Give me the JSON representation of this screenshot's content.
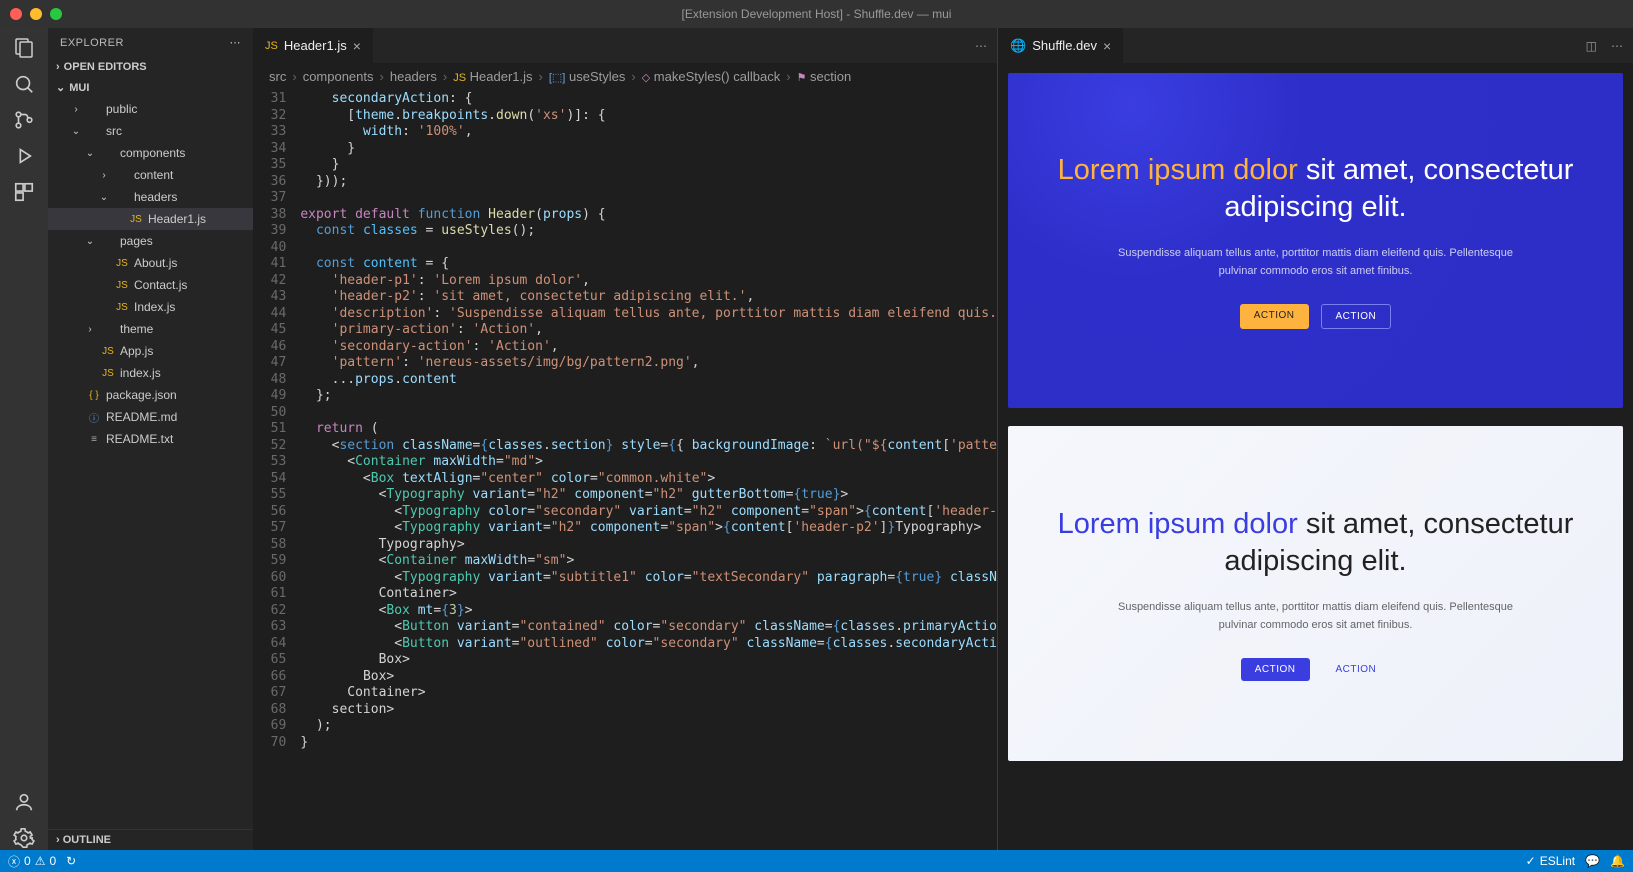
{
  "title": "[Extension Development Host] - Shuffle.dev — mui",
  "explorer": {
    "title": "EXPLORER",
    "outline": "OUTLINE",
    "openEditors": "OPEN EDITORS",
    "root": "MUI"
  },
  "tree": [
    {
      "label": "public",
      "icon": "folder",
      "depth": 1,
      "chev": "›"
    },
    {
      "label": "src",
      "icon": "folder",
      "depth": 1,
      "chev": "⌄"
    },
    {
      "label": "components",
      "icon": "folder",
      "depth": 2,
      "chev": "⌄"
    },
    {
      "label": "content",
      "icon": "folder",
      "depth": 3,
      "chev": "›"
    },
    {
      "label": "headers",
      "icon": "folder",
      "depth": 3,
      "chev": "⌄"
    },
    {
      "label": "Header1.js",
      "icon": "js",
      "depth": 4,
      "chev": "",
      "selected": true
    },
    {
      "label": "pages",
      "icon": "folder",
      "depth": 2,
      "chev": "⌄"
    },
    {
      "label": "About.js",
      "icon": "js",
      "depth": 3,
      "chev": ""
    },
    {
      "label": "Contact.js",
      "icon": "js",
      "depth": 3,
      "chev": ""
    },
    {
      "label": "Index.js",
      "icon": "js",
      "depth": 3,
      "chev": ""
    },
    {
      "label": "theme",
      "icon": "folder",
      "depth": 2,
      "chev": "›"
    },
    {
      "label": "App.js",
      "icon": "js",
      "depth": 2,
      "chev": ""
    },
    {
      "label": "index.js",
      "icon": "js",
      "depth": 2,
      "chev": ""
    },
    {
      "label": "package.json",
      "icon": "json",
      "depth": 1,
      "chev": ""
    },
    {
      "label": "README.md",
      "icon": "md",
      "depth": 1,
      "chev": ""
    },
    {
      "label": "README.txt",
      "icon": "txt",
      "depth": 1,
      "chev": ""
    }
  ],
  "tab": {
    "label": "Header1.js"
  },
  "crumbs": [
    "src",
    "components",
    "headers",
    "Header1.js",
    "useStyles",
    "makeStyles() callback",
    "section"
  ],
  "code": {
    "start": 31,
    "lines": [
      [
        [
          "a",
          "    secondaryAction"
        ],
        [
          "d",
          ": {"
        ]
      ],
      [
        [
          "d",
          "      ["
        ],
        [
          "a",
          "theme"
        ],
        [
          "d",
          "."
        ],
        [
          "a",
          "breakpoints"
        ],
        [
          "d",
          "."
        ],
        [
          "f",
          "down"
        ],
        [
          "d",
          "("
        ],
        [
          "s",
          "'xs'"
        ],
        [
          "d",
          ")]: {"
        ]
      ],
      [
        [
          "d",
          "        "
        ],
        [
          "a",
          "width"
        ],
        [
          "d",
          ": "
        ],
        [
          "s",
          "'100%'"
        ],
        [
          "d",
          ","
        ]
      ],
      [
        [
          "d",
          "      }"
        ]
      ],
      [
        [
          "d",
          "    }"
        ]
      ],
      [
        [
          "d",
          "  }));"
        ]
      ],
      [
        [
          "d",
          ""
        ]
      ],
      [
        [
          "k",
          "export default "
        ],
        [
          "p",
          "function "
        ],
        [
          "f",
          "Header"
        ],
        [
          "d",
          "("
        ],
        [
          "a",
          "props"
        ],
        [
          "d",
          ") {"
        ]
      ],
      [
        [
          "d",
          "  "
        ],
        [
          "p",
          "const "
        ],
        [
          "c",
          "classes"
        ],
        [
          "d",
          " = "
        ],
        [
          "f",
          "useStyles"
        ],
        [
          "d",
          "();"
        ]
      ],
      [
        [
          "d",
          ""
        ]
      ],
      [
        [
          "d",
          "  "
        ],
        [
          "p",
          "const "
        ],
        [
          "c",
          "content"
        ],
        [
          "d",
          " = {"
        ]
      ],
      [
        [
          "d",
          "    "
        ],
        [
          "s",
          "'header-p1'"
        ],
        [
          "d",
          ": "
        ],
        [
          "s",
          "'Lorem ipsum dolor'"
        ],
        [
          "d",
          ","
        ]
      ],
      [
        [
          "d",
          "    "
        ],
        [
          "s",
          "'header-p2'"
        ],
        [
          "d",
          ": "
        ],
        [
          "s",
          "'sit amet, consectetur adipiscing elit.'"
        ],
        [
          "d",
          ","
        ]
      ],
      [
        [
          "d",
          "    "
        ],
        [
          "s",
          "'description'"
        ],
        [
          "d",
          ": "
        ],
        [
          "s",
          "'Suspendisse aliquam tellus ante, porttitor mattis diam eleifend quis."
        ]
      ],
      [
        [
          "d",
          "    "
        ],
        [
          "s",
          "'primary-action'"
        ],
        [
          "d",
          ": "
        ],
        [
          "s",
          "'Action'"
        ],
        [
          "d",
          ","
        ]
      ],
      [
        [
          "d",
          "    "
        ],
        [
          "s",
          "'secondary-action'"
        ],
        [
          "d",
          ": "
        ],
        [
          "s",
          "'Action'"
        ],
        [
          "d",
          ","
        ]
      ],
      [
        [
          "d",
          "    "
        ],
        [
          "s",
          "'pattern'"
        ],
        [
          "d",
          ": "
        ],
        [
          "s",
          "'nereus-assets/img/bg/pattern2.png'"
        ],
        [
          "d",
          ","
        ]
      ],
      [
        [
          "d",
          "    ..."
        ],
        [
          "a",
          "props"
        ],
        [
          "d",
          "."
        ],
        [
          "a",
          "content"
        ]
      ],
      [
        [
          "d",
          "  };"
        ]
      ],
      [
        [
          "d",
          ""
        ]
      ],
      [
        [
          "d",
          "  "
        ],
        [
          "k",
          "return"
        ],
        [
          "d",
          " ("
        ]
      ],
      [
        [
          "d",
          "    <"
        ],
        [
          "p",
          "section "
        ],
        [
          "a",
          "className"
        ],
        [
          "d",
          "="
        ],
        [
          "p",
          "{"
        ],
        [
          "a",
          "classes"
        ],
        [
          "d",
          "."
        ],
        [
          "a",
          "section"
        ],
        [
          "p",
          "} "
        ],
        [
          "a",
          "style"
        ],
        [
          "d",
          "="
        ],
        [
          "p",
          "{"
        ],
        [
          "d",
          "{ "
        ],
        [
          "a",
          "backgroundImage"
        ],
        [
          "d",
          ": "
        ],
        [
          "s",
          "`url(\"${"
        ],
        [
          "a",
          "content"
        ],
        [
          "d",
          "["
        ],
        [
          "s",
          "'patte"
        ]
      ],
      [
        [
          "d",
          "      <"
        ],
        [
          "t",
          "Container "
        ],
        [
          "a",
          "maxWidth"
        ],
        [
          "d",
          "="
        ],
        [
          "s",
          "\"md\""
        ],
        [
          "d",
          ">"
        ]
      ],
      [
        [
          "d",
          "        <"
        ],
        [
          "t",
          "Box "
        ],
        [
          "a",
          "textAlign"
        ],
        [
          "d",
          "="
        ],
        [
          "s",
          "\"center\" "
        ],
        [
          "a",
          "color"
        ],
        [
          "d",
          "="
        ],
        [
          "s",
          "\"common.white\""
        ],
        [
          "d",
          ">"
        ]
      ],
      [
        [
          "d",
          "          <"
        ],
        [
          "t",
          "Typography "
        ],
        [
          "a",
          "variant"
        ],
        [
          "d",
          "="
        ],
        [
          "s",
          "\"h2\" "
        ],
        [
          "a",
          "component"
        ],
        [
          "d",
          "="
        ],
        [
          "s",
          "\"h2\" "
        ],
        [
          "a",
          "gutterBottom"
        ],
        [
          "d",
          "="
        ],
        [
          "p",
          "{"
        ],
        [
          "p",
          "true"
        ],
        [
          "p",
          "}"
        ],
        [
          "d",
          ">"
        ]
      ],
      [
        [
          "d",
          "            <"
        ],
        [
          "t",
          "Typography "
        ],
        [
          "a",
          "color"
        ],
        [
          "d",
          "="
        ],
        [
          "s",
          "\"secondary\" "
        ],
        [
          "a",
          "variant"
        ],
        [
          "d",
          "="
        ],
        [
          "s",
          "\"h2\" "
        ],
        [
          "a",
          "component"
        ],
        [
          "d",
          "="
        ],
        [
          "s",
          "\"span\""
        ],
        [
          "d",
          ">"
        ],
        [
          "p",
          "{"
        ],
        [
          "a",
          "content"
        ],
        [
          "d",
          "["
        ],
        [
          "s",
          "'header-"
        ]
      ],
      [
        [
          "d",
          "            <"
        ],
        [
          "t",
          "Typography "
        ],
        [
          "a",
          "variant"
        ],
        [
          "d",
          "="
        ],
        [
          "s",
          "\"h2\" "
        ],
        [
          "a",
          "component"
        ],
        [
          "d",
          "="
        ],
        [
          "s",
          "\"span\""
        ],
        [
          "d",
          ">"
        ],
        [
          "p",
          "{"
        ],
        [
          "a",
          "content"
        ],
        [
          "d",
          "["
        ],
        [
          "s",
          "'header-p2'"
        ],
        [
          "d",
          "]"
        ],
        [
          "p",
          "}"
        ],
        [
          "d",
          "</"
        ],
        [
          "t",
          "Typography"
        ],
        [
          "d",
          ">"
        ]
      ],
      [
        [
          "d",
          "          </"
        ],
        [
          "t",
          "Typography"
        ],
        [
          "d",
          ">"
        ]
      ],
      [
        [
          "d",
          "          <"
        ],
        [
          "t",
          "Container "
        ],
        [
          "a",
          "maxWidth"
        ],
        [
          "d",
          "="
        ],
        [
          "s",
          "\"sm\""
        ],
        [
          "d",
          ">"
        ]
      ],
      [
        [
          "d",
          "            <"
        ],
        [
          "t",
          "Typography "
        ],
        [
          "a",
          "variant"
        ],
        [
          "d",
          "="
        ],
        [
          "s",
          "\"subtitle1\" "
        ],
        [
          "a",
          "color"
        ],
        [
          "d",
          "="
        ],
        [
          "s",
          "\"textSecondary\" "
        ],
        [
          "a",
          "paragraph"
        ],
        [
          "d",
          "="
        ],
        [
          "p",
          "{"
        ],
        [
          "p",
          "true"
        ],
        [
          "p",
          "} "
        ],
        [
          "a",
          "classN"
        ]
      ],
      [
        [
          "d",
          "          </"
        ],
        [
          "t",
          "Container"
        ],
        [
          "d",
          ">"
        ]
      ],
      [
        [
          "d",
          "          <"
        ],
        [
          "t",
          "Box "
        ],
        [
          "a",
          "mt"
        ],
        [
          "d",
          "="
        ],
        [
          "p",
          "{"
        ],
        [
          "n",
          "3"
        ],
        [
          "p",
          "}"
        ],
        [
          "d",
          ">"
        ]
      ],
      [
        [
          "d",
          "            <"
        ],
        [
          "t",
          "Button "
        ],
        [
          "a",
          "variant"
        ],
        [
          "d",
          "="
        ],
        [
          "s",
          "\"contained\" "
        ],
        [
          "a",
          "color"
        ],
        [
          "d",
          "="
        ],
        [
          "s",
          "\"secondary\" "
        ],
        [
          "a",
          "className"
        ],
        [
          "d",
          "="
        ],
        [
          "p",
          "{"
        ],
        [
          "a",
          "classes"
        ],
        [
          "d",
          "."
        ],
        [
          "a",
          "primaryActio"
        ]
      ],
      [
        [
          "d",
          "            <"
        ],
        [
          "t",
          "Button "
        ],
        [
          "a",
          "variant"
        ],
        [
          "d",
          "="
        ],
        [
          "s",
          "\"outlined\" "
        ],
        [
          "a",
          "color"
        ],
        [
          "d",
          "="
        ],
        [
          "s",
          "\"secondary\" "
        ],
        [
          "a",
          "className"
        ],
        [
          "d",
          "="
        ],
        [
          "p",
          "{"
        ],
        [
          "a",
          "classes"
        ],
        [
          "d",
          "."
        ],
        [
          "a",
          "secondaryActi"
        ]
      ],
      [
        [
          "d",
          "          </"
        ],
        [
          "t",
          "Box"
        ],
        [
          "d",
          ">"
        ]
      ],
      [
        [
          "d",
          "        </"
        ],
        [
          "t",
          "Box"
        ],
        [
          "d",
          ">"
        ]
      ],
      [
        [
          "d",
          "      </"
        ],
        [
          "t",
          "Container"
        ],
        [
          "d",
          ">"
        ]
      ],
      [
        [
          "d",
          "    </"
        ],
        [
          "p",
          "section"
        ],
        [
          "d",
          ">"
        ]
      ],
      [
        [
          "d",
          "  );"
        ]
      ],
      [
        [
          "d",
          "}"
        ]
      ]
    ]
  },
  "preview": {
    "tab": "Shuffle.dev",
    "h1a": "Lorem ipsum dolor ",
    "h1b": "sit amet, consectetur adipiscing elit.",
    "desc": "Suspendisse aliquam tellus ante, porttitor mattis diam eleifend quis. Pellentesque pulvinar commodo eros sit amet finibus.",
    "btn1": "ACTION",
    "btn2": "ACTION"
  },
  "status": {
    "errors": "0",
    "warnings": "0",
    "eslint": "ESLint"
  }
}
